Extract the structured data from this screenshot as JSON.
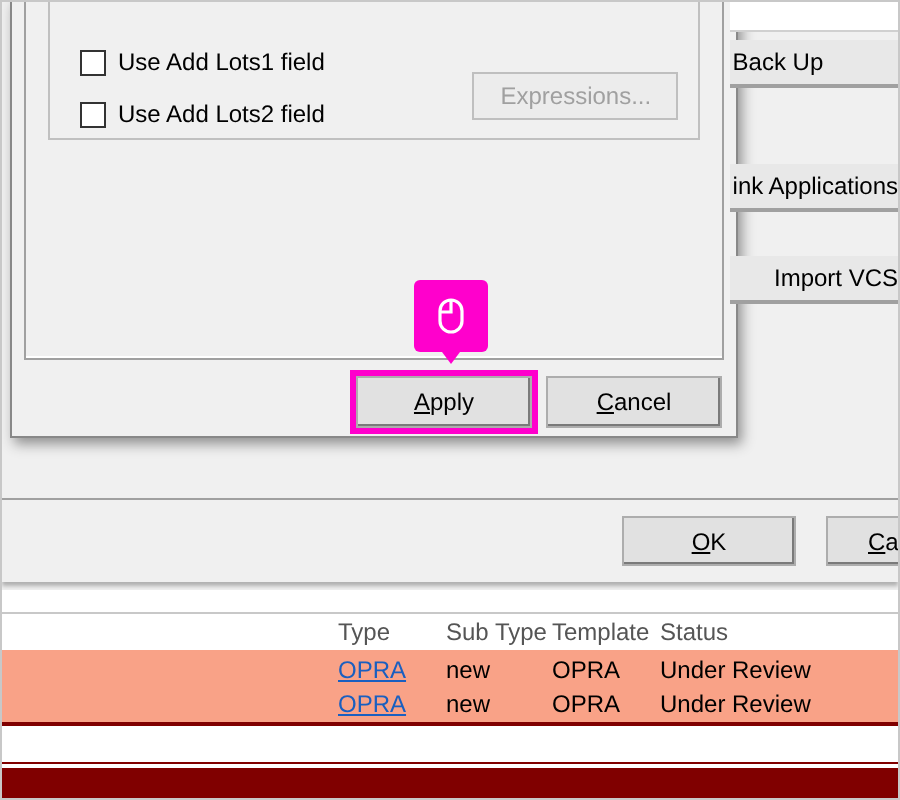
{
  "main_window": {
    "side_buttons": [
      "Back Up",
      "ink Applications",
      "Import VCS"
    ],
    "footer_buttons": [
      "OK",
      "Ca"
    ],
    "table": {
      "columns": [
        "Type",
        "Sub Type",
        "Template",
        "Status"
      ],
      "rows": [
        {
          "cells": [
            "OPRA",
            "new",
            "OPRA",
            "Under Review"
          ]
        },
        {
          "cells": [
            "OPRA",
            "new",
            "OPRA",
            "Under Review"
          ]
        }
      ]
    }
  },
  "dialog": {
    "checkboxes": [
      {
        "label": "Use Add Lots1 field",
        "checked": false
      },
      {
        "label": "Use Add Lots2 field",
        "checked": false
      }
    ],
    "expressions_button": {
      "label": "Expressions...",
      "disabled": true
    },
    "buttons": [
      {
        "label": "Apply",
        "highlighted": true
      },
      {
        "label": "Cancel",
        "highlighted": false
      }
    ]
  }
}
